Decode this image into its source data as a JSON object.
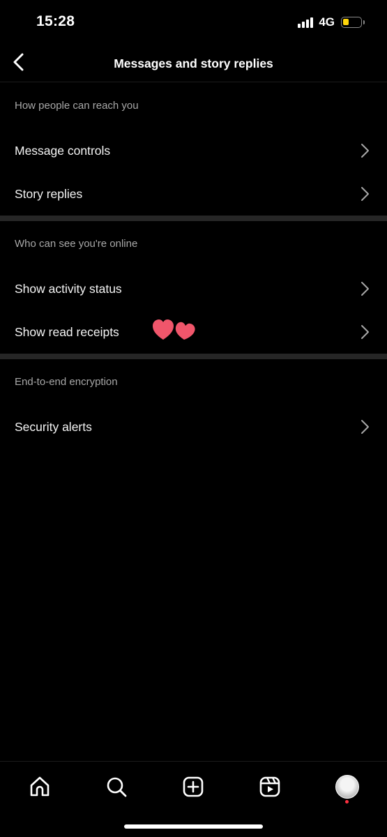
{
  "status_bar": {
    "time": "15:28",
    "network": "4G",
    "battery_level": 0.35,
    "battery_color": "#ffd60a"
  },
  "header": {
    "title": "Messages and story replies",
    "back_icon": "chevron-left-icon"
  },
  "sections": [
    {
      "title": "How people can reach you",
      "items": [
        {
          "label": "Message controls"
        },
        {
          "label": "Story replies"
        }
      ]
    },
    {
      "title": "Who can see you're online",
      "items": [
        {
          "label": "Show activity status"
        },
        {
          "label": "Show read receipts"
        }
      ]
    },
    {
      "title": "End-to-end encryption",
      "items": [
        {
          "label": "Security alerts"
        }
      ]
    }
  ],
  "sticker": {
    "icon": "two-hearts-icon",
    "color": "#f0566b"
  },
  "tab_bar": {
    "tabs": [
      "home-icon",
      "search-icon",
      "create-icon",
      "reels-icon",
      "profile-avatar"
    ],
    "notification_dot_color": "#ff3040"
  }
}
